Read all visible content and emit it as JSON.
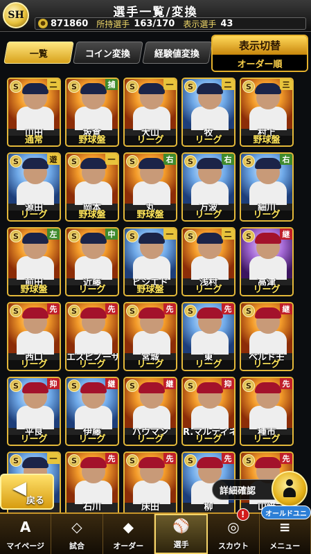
{
  "header": {
    "logo": "SH",
    "title": "選手一覧/変換",
    "coins": "871860",
    "owned_label": "所持選手",
    "owned_value": "163/170",
    "display_label": "表示選手",
    "display_value": "43"
  },
  "tabs": [
    "一覧",
    "コイン変換",
    "経験値変換"
  ],
  "order": {
    "label": "表示切替",
    "value": "オーダー順"
  },
  "players": [
    {
      "name": "山田",
      "type": "通常",
      "pos": "二",
      "pos_color": "gold",
      "photo": "orange"
    },
    {
      "name": "坂倉",
      "type": "野球盤",
      "pos": "捕",
      "pos_color": "green",
      "photo": "orange"
    },
    {
      "name": "大山",
      "type": "リーグ",
      "pos": "一",
      "pos_color": "gold",
      "photo": "orange"
    },
    {
      "name": "牧",
      "type": "リーグ",
      "pos": "二",
      "pos_color": "gold",
      "photo": "blue"
    },
    {
      "name": "村上",
      "type": "野球盤",
      "pos": "三",
      "pos_color": "gold",
      "photo": "orange"
    },
    {
      "name": "源田",
      "type": "リーグ",
      "pos": "遊",
      "pos_color": "gold",
      "photo": "blue"
    },
    {
      "name": "岡本",
      "type": "野球盤",
      "pos": "一",
      "pos_color": "gold",
      "photo": "orange"
    },
    {
      "name": "丸",
      "type": "野球盤",
      "pos": "右",
      "pos_color": "green",
      "photo": "orange"
    },
    {
      "name": "万波",
      "type": "リーグ",
      "pos": "右",
      "pos_color": "green",
      "photo": "blue"
    },
    {
      "name": "細川",
      "type": "リーグ",
      "pos": "右",
      "pos_color": "green",
      "photo": "blue"
    },
    {
      "name": "前田",
      "type": "野球盤",
      "pos": "左",
      "pos_color": "green",
      "photo": "orange"
    },
    {
      "name": "近藤",
      "type": "リーグ",
      "pos": "中",
      "pos_color": "green",
      "photo": "orange"
    },
    {
      "name": "ビシエド",
      "type": "野球盤",
      "pos": "一",
      "pos_color": "gold",
      "photo": "blue"
    },
    {
      "name": "浅村",
      "type": "リーグ",
      "pos": "二",
      "pos_color": "gold",
      "photo": "orange"
    },
    {
      "name": "高津",
      "type": "リーグ",
      "pos": "継",
      "pos_color": "red",
      "photo": "purple"
    },
    {
      "name": "西口",
      "type": "リーグ",
      "pos": "先",
      "pos_color": "red",
      "photo": "orange"
    },
    {
      "name": "エスピノーザ",
      "type": "リーグ",
      "pos": "先",
      "pos_color": "red",
      "photo": "orange"
    },
    {
      "name": "宮城",
      "type": "リーグ",
      "pos": "先",
      "pos_color": "red",
      "photo": "orange"
    },
    {
      "name": "東",
      "type": "リーグ",
      "pos": "先",
      "pos_color": "red",
      "photo": "blue"
    },
    {
      "name": "ベルドモ",
      "type": "リーグ",
      "pos": "継",
      "pos_color": "red",
      "photo": "orange"
    },
    {
      "name": "平良",
      "type": "リーグ",
      "pos": "抑",
      "pos_color": "red",
      "photo": "blue"
    },
    {
      "name": "伊藤",
      "type": "リーグ",
      "pos": "継",
      "pos_color": "red",
      "photo": "blue"
    },
    {
      "name": "バウマン",
      "type": "リーグ",
      "pos": "継",
      "pos_color": "red",
      "photo": "orange"
    },
    {
      "name": "R.マルティネス",
      "type": "リーグ",
      "pos": "抑",
      "pos_color": "red",
      "photo": "orange"
    },
    {
      "name": "種市",
      "type": "リーグ",
      "pos": "先",
      "pos_color": "red",
      "photo": "orange"
    },
    {
      "name": "",
      "type": "",
      "pos": "一",
      "pos_color": "gold",
      "photo": "blue"
    },
    {
      "name": "石川",
      "type": "",
      "pos": "先",
      "pos_color": "red",
      "photo": "orange"
    },
    {
      "name": "床田",
      "type": "",
      "pos": "先",
      "pos_color": "red",
      "photo": "orange"
    },
    {
      "name": "柳",
      "type": "",
      "pos": "先",
      "pos_color": "red",
      "photo": "blue"
    },
    {
      "name": "山﨑",
      "type": "",
      "pos": "先",
      "pos_color": "red",
      "photo": "orange"
    }
  ],
  "buttons": {
    "back": "戻る",
    "detail": "詳細確認"
  },
  "nav": [
    {
      "label": "マイページ",
      "icon": "A"
    },
    {
      "label": "試合",
      "icon": "◇"
    },
    {
      "label": "オーダー",
      "icon": "◆"
    },
    {
      "label": "選手",
      "icon": "⚾"
    },
    {
      "label": "スカウト",
      "icon": "◎",
      "badge": "!"
    },
    {
      "label": "メニュー",
      "icon": "≡"
    }
  ],
  "speech": "オールドユニ"
}
